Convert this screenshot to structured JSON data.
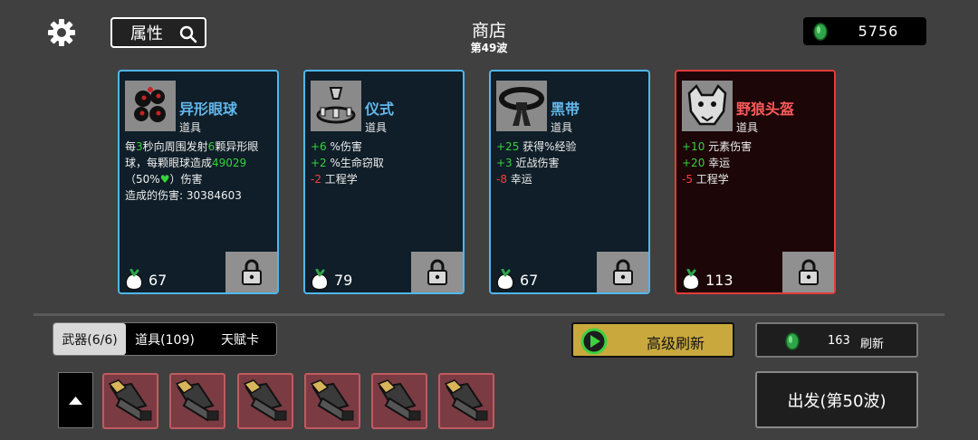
{
  "header": {
    "attr_label": "属性",
    "shop_title": "商店",
    "wave_label": "第49波",
    "money": "5756"
  },
  "cards": [
    {
      "name": "异形眼球",
      "type": "道具",
      "desc_parts": [
        {
          "t": "每",
          "c": "y"
        },
        {
          "t": "3",
          "c": "g"
        },
        {
          "t": "秒向周围发射",
          "c": "y"
        },
        {
          "t": "6",
          "c": "g"
        },
        {
          "t": "颗异形眼球，每颗眼球造成",
          "c": "y"
        },
        {
          "t": "49029",
          "c": "g"
        },
        {
          "t": "（50%",
          "c": "y"
        },
        {
          "t": "♥",
          "c": "g"
        },
        {
          "t": "）伤害",
          "c": "y"
        }
      ],
      "extra": "造成的伤害: 30384603",
      "price": "67",
      "border": "blue"
    },
    {
      "name": "仪式",
      "type": "道具",
      "stats": [
        {
          "val": "+6",
          "c": "g",
          "label": "%伤害"
        },
        {
          "val": "+2",
          "c": "g",
          "label": "%生命窃取"
        },
        {
          "val": "-2",
          "c": "r",
          "label": "工程学"
        }
      ],
      "price": "79",
      "border": "blue"
    },
    {
      "name": "黑带",
      "type": "道具",
      "stats": [
        {
          "val": "+25",
          "c": "g",
          "label": "获得%经验"
        },
        {
          "val": "+3",
          "c": "g",
          "label": "近战伤害"
        },
        {
          "val": "-8",
          "c": "r",
          "label": "幸运"
        }
      ],
      "price": "67",
      "border": "blue"
    },
    {
      "name": "野狼头盔",
      "type": "道具",
      "stats": [
        {
          "val": "+10",
          "c": "g",
          "label": "元素伤害"
        },
        {
          "val": "+20",
          "c": "g",
          "label": "幸运"
        },
        {
          "val": "-5",
          "c": "r",
          "label": "工程学"
        }
      ],
      "price": "113",
      "border": "red"
    }
  ],
  "tabs": [
    "武器(6/6)",
    "道具(109)",
    "天赋卡"
  ],
  "buttons": {
    "advanced_refresh": "高级刷新",
    "refresh_cost": "163",
    "refresh": "刷新",
    "start": "出发(第50波)"
  },
  "colors": {
    "accent_blue": "#4fb6ee",
    "accent_red": "#e23b3b",
    "positive": "#34d33b",
    "negative": "#ff3b3b",
    "gold_button": "#c9a93e"
  },
  "icons": {
    "settings": "gear-icon",
    "search": "search-icon",
    "currency": "green-coin-icon",
    "lock": "lock-icon",
    "play": "play-icon",
    "up": "up-arrow-icon",
    "weapon": "minigun-icon"
  }
}
